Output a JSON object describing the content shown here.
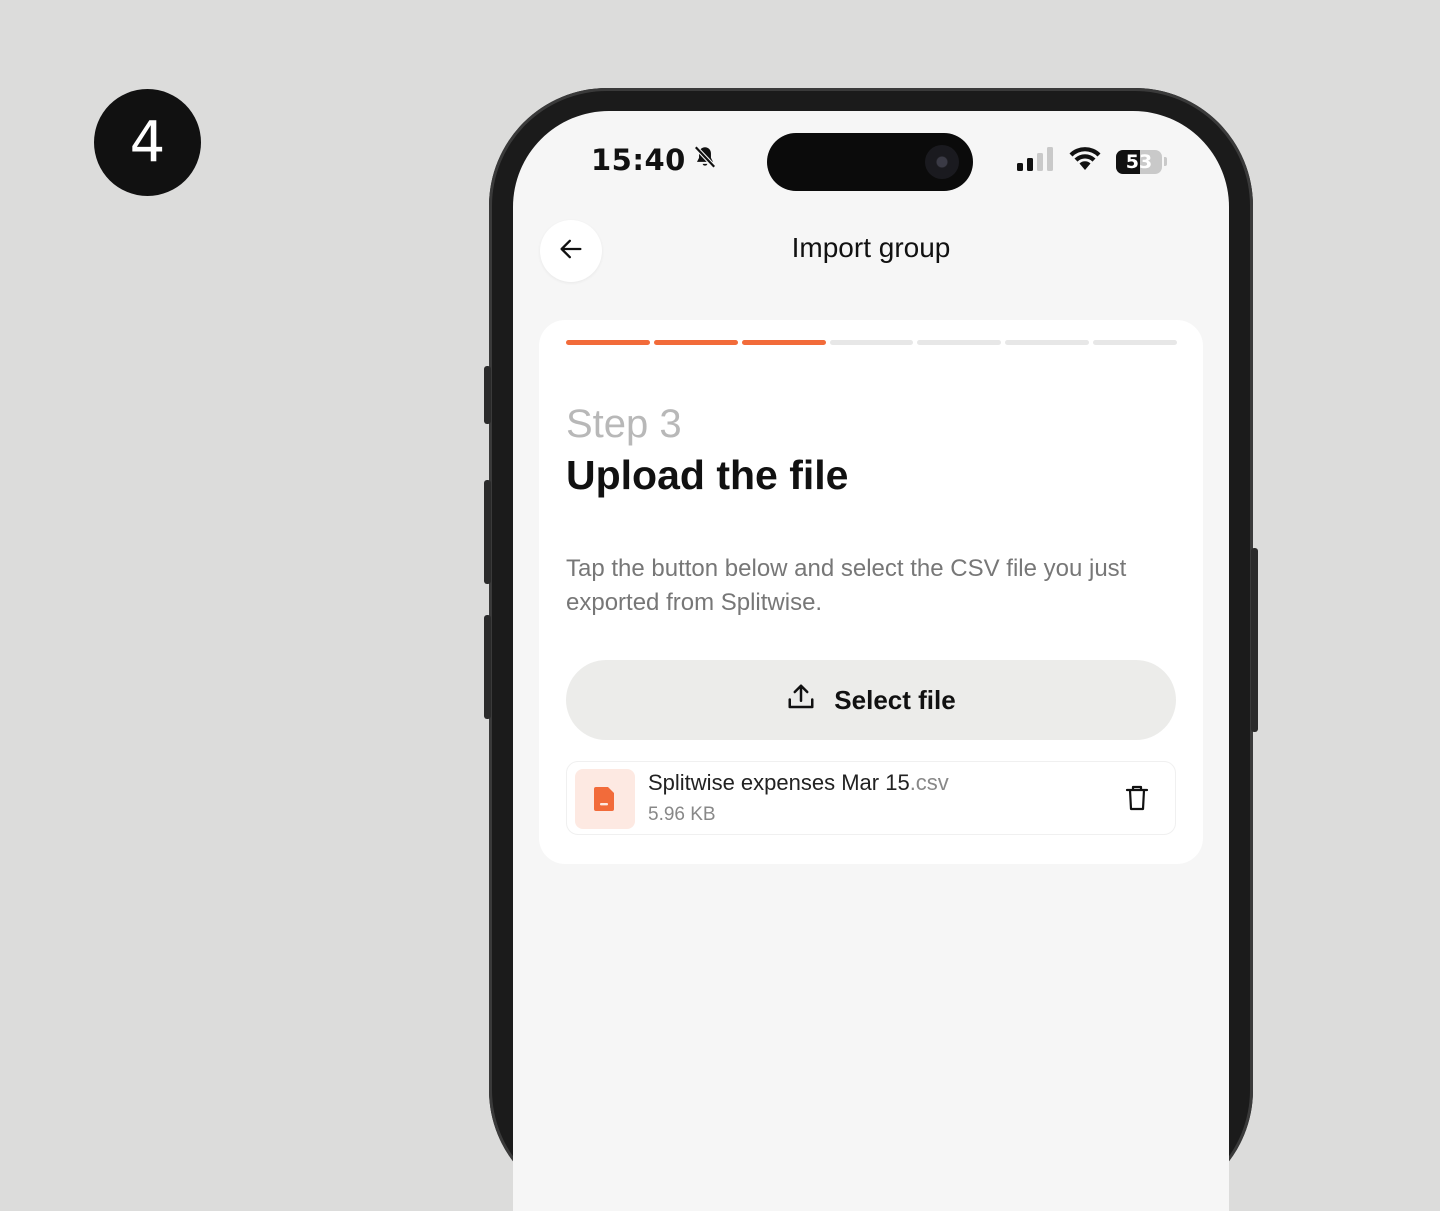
{
  "badge": {
    "number": "4"
  },
  "status_bar": {
    "time": "15:40",
    "battery_percent": "53",
    "battery_level": 0.53,
    "icons": [
      "bell-slash-icon",
      "cellular-signal-icon",
      "wifi-icon",
      "battery-icon"
    ]
  },
  "nav": {
    "back_icon": "arrow-left-icon",
    "title": "Import group"
  },
  "progress": {
    "total_steps": 7,
    "completed_steps": 3,
    "accent_color": "#f26b3a",
    "inactive_color": "#e7e7e7"
  },
  "step": {
    "label": "Step 3",
    "title": "Upload the file",
    "description": "Tap the button below and select the CSV file you just exported from Splitwise."
  },
  "select_button": {
    "icon": "upload-icon",
    "label": "Select file"
  },
  "file": {
    "icon": "file-icon",
    "name_base": "Splitwise expenses Mar 15",
    "name_ext": ".csv",
    "size": "5.96 KB",
    "delete_icon": "trash-icon"
  }
}
